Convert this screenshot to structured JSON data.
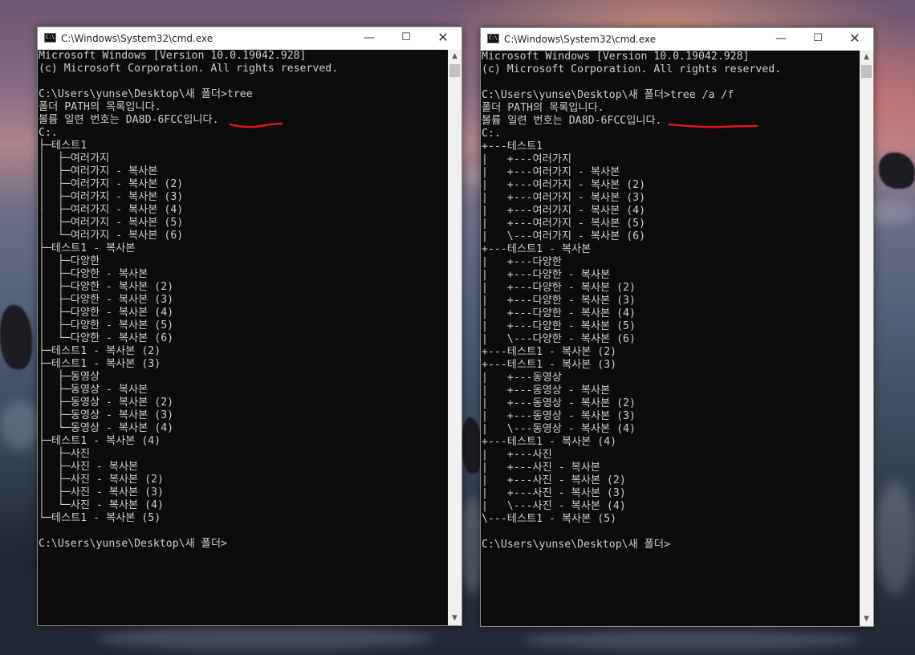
{
  "windows": [
    {
      "title": "C:\\Windows\\System32\\cmd.exe",
      "controls": {
        "minimize": "—",
        "maximize": "☐",
        "close": "✕"
      },
      "lines": [
        "Microsoft Windows [Version 10.0.19042.928]",
        "(c) Microsoft Corporation. All rights reserved.",
        "",
        "C:\\Users\\yunse\\Desktop\\새 폴더>tree",
        "폴더 PATH의 목록입니다.",
        "볼륨 일련 번호는 DA8D-6FCC입니다.",
        "C:.",
        "├─테스트1",
        "│  ├─여러가지",
        "│  ├─여러가지 - 복사본",
        "│  ├─여러가지 - 복사본 (2)",
        "│  ├─여러가지 - 복사본 (3)",
        "│  ├─여러가지 - 복사본 (4)",
        "│  ├─여러가지 - 복사본 (5)",
        "│  └─여러가지 - 복사본 (6)",
        "├─테스트1 - 복사본",
        "│  ├─다양한",
        "│  ├─다양한 - 복사본",
        "│  ├─다양한 - 복사본 (2)",
        "│  ├─다양한 - 복사본 (3)",
        "│  ├─다양한 - 복사본 (4)",
        "│  ├─다양한 - 복사본 (5)",
        "│  └─다양한 - 복사본 (6)",
        "├─테스트1 - 복사본 (2)",
        "├─테스트1 - 복사본 (3)",
        "│  ├─동영상",
        "│  ├─동영상 - 복사본",
        "│  ├─동영상 - 복사본 (2)",
        "│  ├─동영상 - 복사본 (3)",
        "│  └─동영상 - 복사본 (4)",
        "├─테스트1 - 복사본 (4)",
        "│  ├─사진",
        "│  ├─사진 - 복사본",
        "│  ├─사진 - 복사본 (2)",
        "│  ├─사진 - 복사본 (3)",
        "│  └─사진 - 복사본 (4)",
        "└─테스트1 - 복사본 (5)",
        "",
        "C:\\Users\\yunse\\Desktop\\새 폴더>"
      ]
    },
    {
      "title": "C:\\Windows\\System32\\cmd.exe",
      "controls": {
        "minimize": "—",
        "maximize": "☐",
        "close": "✕"
      },
      "lines": [
        "Microsoft Windows [Version 10.0.19042.928]",
        "(c) Microsoft Corporation. All rights reserved.",
        "",
        "C:\\Users\\yunse\\Desktop\\새 폴더>tree /a /f",
        "폴더 PATH의 목록입니다.",
        "볼륨 일련 번호는 DA8D-6FCC입니다.",
        "C:.",
        "+---테스트1",
        "|   +---여러가지",
        "|   +---여러가지 - 복사본",
        "|   +---여러가지 - 복사본 (2)",
        "|   +---여러가지 - 복사본 (3)",
        "|   +---여러가지 - 복사본 (4)",
        "|   +---여러가지 - 복사본 (5)",
        "|   \\---여러가지 - 복사본 (6)",
        "+---테스트1 - 복사본",
        "|   +---다양한",
        "|   +---다양한 - 복사본",
        "|   +---다양한 - 복사본 (2)",
        "|   +---다양한 - 복사본 (3)",
        "|   +---다양한 - 복사본 (4)",
        "|   +---다양한 - 복사본 (5)",
        "|   \\---다양한 - 복사본 (6)",
        "+---테스트1 - 복사본 (2)",
        "+---테스트1 - 복사본 (3)",
        "|   +---동영상",
        "|   +---동영상 - 복사본",
        "|   +---동영상 - 복사본 (2)",
        "|   +---동영상 - 복사본 (3)",
        "|   \\---동영상 - 복사본 (4)",
        "+---테스트1 - 복사본 (4)",
        "|   +---사진",
        "|   +---사진 - 복사본",
        "|   +---사진 - 복사본 (2)",
        "|   +---사진 - 복사본 (3)",
        "|   \\---사진 - 복사본 (4)",
        "\\---테스트1 - 복사본 (5)",
        "",
        "C:\\Users\\yunse\\Desktop\\새 폴더>"
      ]
    }
  ],
  "colors": {
    "console_bg": "#0c0c0c",
    "console_text": "#cccccc",
    "annotation": "#e0141e",
    "titlebar": "#ffffff"
  },
  "icons": {
    "app": "cmd-icon",
    "scroll_up": "chevron-up-icon",
    "scroll_down": "chevron-down-icon"
  }
}
